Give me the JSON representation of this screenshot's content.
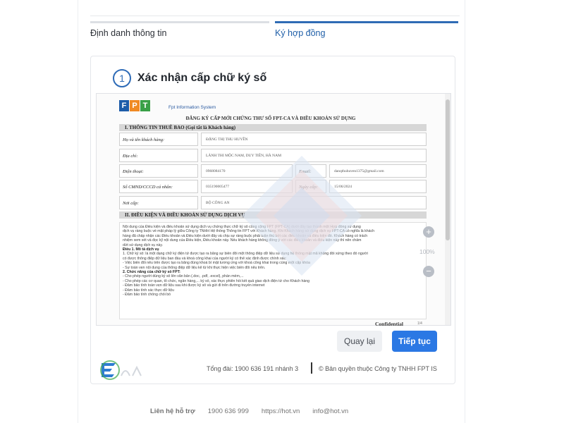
{
  "tabs": [
    {
      "label": "Định danh thông tin",
      "active": false
    },
    {
      "label": "Ký hợp đồng",
      "active": true
    }
  ],
  "step": {
    "number": "1",
    "title": "Xác nhận cấp chữ ký số"
  },
  "document": {
    "brand": "Fpt Information System",
    "title": "ĐĂNG KÝ CẤP MỚI CHỨNG THƯ SỐ FPT-CA VÀ ĐIỀU KHOẢN SỬ DỤNG",
    "section1": "I.   THÔNG TIN THUÊ BAO (Gọi tắt là Khách hàng)",
    "fields": {
      "name_label": "Họ và tên khách hàng:",
      "name_value": "ĐẶNG THỊ THU HUYỀN",
      "address_label": "Địa chỉ:",
      "address_value": "LÀNH THI MỘC NAM, DUY TIÊN, HÀ NAM",
      "phone_label": "Điện thoại:",
      "phone_value": "0968084170",
      "email_label": "Email:",
      "email_value": "danqthuhuven1375@gmail.com",
      "id_label": "Số CMND/CCCD cá nhân:",
      "id_value": "035190005477",
      "issue_label": "Ngày cấp:",
      "issue_value": "15/06/2024",
      "place_label": "Nơi cấp:",
      "place_value": "BỘ CÔNG AN"
    },
    "section2": "II.  ĐIỀU KIỆN VÀ ĐIỀU KHOẢN SỬ DỤNG DỊCH VỤ",
    "body_lines": [
      "Nội dung của Điều kiện và điều khoản sử dụng dịch vụ chứng thực chữ ký số công cộng FPT (FPT-CA) dưới đây tạo thành một Hợp đồng sử dụng",
      "dịch vụ ràng buộc về mặt pháp lý giữa Công ty TNHH Hệ thống Thông tin FPT với Khách hàng. Khi Khách hàng sử dụng dịch vụ FPT-CA có nghĩa là khách",
      "hàng đã chấp nhận các Điều khoản và Điều kiện dưới đây và chịu sự ràng buộc phải tuân thủ bởi các điều khoản và điều kiện đó. Khách hàng có trách",
      "nhiệm xem xét và đọc kỹ nội dung của Điều kiện, Điều khoản này. Nếu khách hàng không đồng ý với các điều khoản và điều kiện này thì nên chấm",
      "dứt sử dụng dịch vụ này.",
      "Điều 1. Mô tả dịch vụ",
      "1. Chữ ký số: là một dạng chữ ký điện tử được tạo ra bằng sự biến đổi một thông điệp dữ liệu sử dụng hệ thống mật mã không đối xứng theo đó người",
      "có được thông điệp dữ liệu ban đầu và khoá công khai của người ký có thể xác định được chính xác:",
      "- Việc biến đổi nêu trên được tạo ra bằng đúng khoá bí mật tương ứng với khoá  công khai trong cùng một cặp khóa",
      "- Sự toàn vẹn nội dung của thông điệp dữ liệu kể từ khi thực hiện việc biến đổi nêu trên.",
      "2. Chức năng của chữ ký số FPT:",
      "- Cho phép người dùng ký số lên văn bản (.doc, .pdf, .excel), phần mềm,...",
      "- Cho phép các cơ quan, tổ chức, ngân hàng,... ký số, xác thực phiên hồi kết quả giao dịch điện tử cho Khách hàng",
      "- Đảm bảo tính toàn vẹn dữ liệu sau khi được ký số và gửi đi trên đường truyền internet",
      "- Đảm bảo tính xác thực dữ liệu",
      "- Đảm bảo tính chống chối bỏ"
    ],
    "confidential": "Confidential",
    "page": "1/4"
  },
  "zoom": {
    "level": "100%"
  },
  "buttons": {
    "back": "Quay lại",
    "next": "Tiếp tục"
  },
  "footer": {
    "hotline": "Tổng đài: 1900 636 191 nhánh 3",
    "copyright": "© Bản quyền thuộc Công ty TNHH FPT IS",
    "contact_label": "Liên hệ hỗ trợ",
    "contact_phone": "1900 636 999",
    "contact_site": "https://hot.vn",
    "contact_email": "info@hot.vn"
  },
  "colors": {
    "accent": "#2b78e4",
    "tab_active": "#2f6bb5",
    "step": "#2e6bb7"
  }
}
